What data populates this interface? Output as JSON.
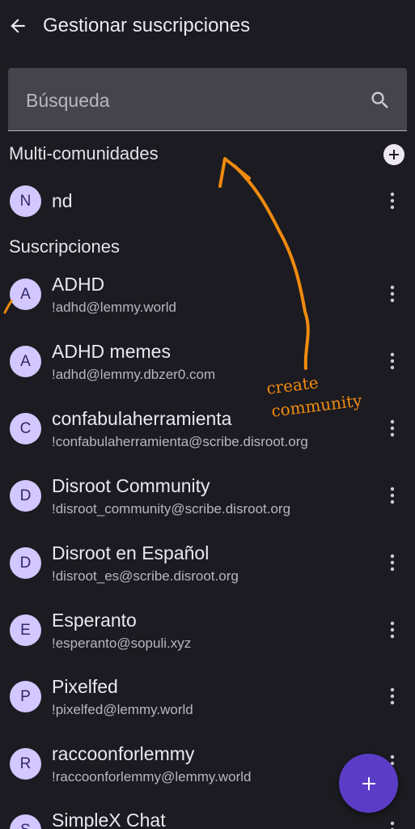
{
  "header": {
    "title": "Gestionar suscripciones",
    "back_icon": "arrow-left-icon"
  },
  "search": {
    "placeholder": "Búsqueda",
    "value": "",
    "icon": "search-icon"
  },
  "multi": {
    "title": "Multi-comunidades",
    "add_icon": "add-circle-icon",
    "items": [
      {
        "initial": "N",
        "name": "nd"
      }
    ]
  },
  "subscriptions": {
    "title": "Suscripciones",
    "items": [
      {
        "initial": "A",
        "name": "ADHD",
        "handle": "!adhd@lemmy.world"
      },
      {
        "initial": "A",
        "name": "ADHD memes",
        "handle": "!adhd@lemmy.dbzer0.com"
      },
      {
        "initial": "C",
        "name": "confabulaherramienta",
        "handle": "!confabulaherramienta@scribe.disroot.org"
      },
      {
        "initial": "D",
        "name": "Disroot Community",
        "handle": "!disroot_community@scribe.disroot.org"
      },
      {
        "initial": "D",
        "name": "Disroot en Español",
        "handle": "!disroot_es@scribe.disroot.org"
      },
      {
        "initial": "E",
        "name": "Esperanto",
        "handle": "!esperanto@sopuli.xyz"
      },
      {
        "initial": "P",
        "name": "Pixelfed",
        "handle": "!pixelfed@lemmy.world"
      },
      {
        "initial": "R",
        "name": "raccoonforlemmy",
        "handle": "!raccoonforlemmy@lemmy.world"
      },
      {
        "initial": "S",
        "name": "SimpleX Chat",
        "handle": ""
      }
    ]
  },
  "fab": {
    "icon": "plus-icon"
  },
  "annotation": {
    "line1": "create",
    "line2": "community",
    "color": "#f08a0f"
  },
  "colors": {
    "background": "#1b1b21",
    "avatar": "#d3c7ff",
    "fab": "#5b3cc6",
    "search_field": "#45444c"
  }
}
